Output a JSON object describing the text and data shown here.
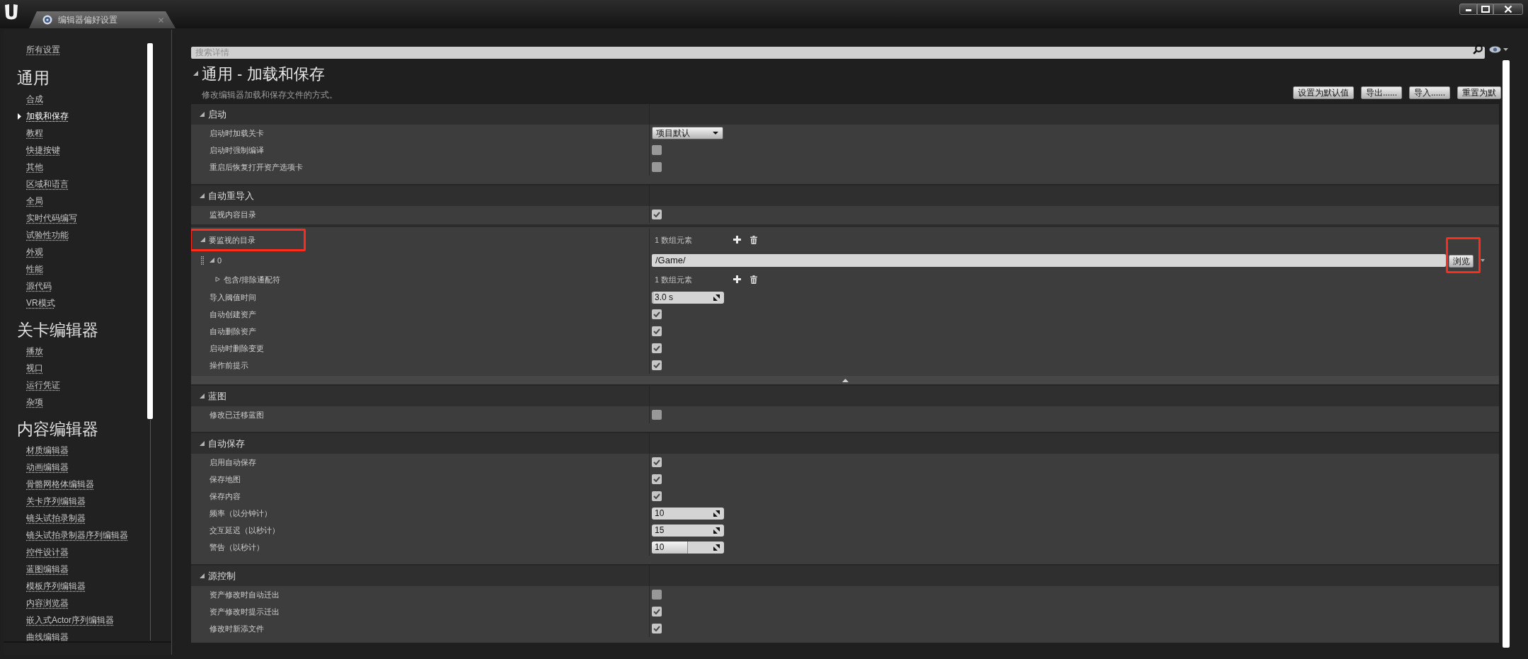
{
  "window": {
    "tab": {
      "title": "编辑器偏好设置"
    }
  },
  "sidebar": {
    "top_link": {
      "label": "所有设置",
      "selected": false
    },
    "sections": [
      {
        "heading": "通用",
        "items": [
          {
            "label": "合成",
            "selected": false
          },
          {
            "label": "加载和保存",
            "selected": true
          },
          {
            "label": "教程",
            "selected": false
          },
          {
            "label": "快捷按键",
            "selected": false
          },
          {
            "label": "其他",
            "selected": false
          },
          {
            "label": "区域和语言",
            "selected": false
          },
          {
            "label": "全局",
            "selected": false
          },
          {
            "label": "实时代码编写",
            "selected": false
          },
          {
            "label": "试验性功能",
            "selected": false
          },
          {
            "label": "外观",
            "selected": false
          },
          {
            "label": "性能",
            "selected": false
          },
          {
            "label": "源代码",
            "selected": false
          },
          {
            "label": "VR模式",
            "selected": false
          }
        ]
      },
      {
        "heading": "关卡编辑器",
        "items": [
          {
            "label": "播放",
            "selected": false
          },
          {
            "label": "视口",
            "selected": false
          },
          {
            "label": "运行凭证",
            "selected": false
          },
          {
            "label": "杂项",
            "selected": false
          }
        ]
      },
      {
        "heading": "内容编辑器",
        "items": [
          {
            "label": "材质编辑器",
            "selected": false
          },
          {
            "label": "动画编辑器",
            "selected": false
          },
          {
            "label": "骨骼网格体编辑器",
            "selected": false
          },
          {
            "label": "关卡序列编辑器",
            "selected": false
          },
          {
            "label": "镜头试拍录制器",
            "selected": false
          },
          {
            "label": "镜头试拍录制器序列编辑器",
            "selected": false
          },
          {
            "label": "控件设计器",
            "selected": false
          },
          {
            "label": "蓝图编辑器",
            "selected": false
          },
          {
            "label": "模板序列编辑器",
            "selected": false
          },
          {
            "label": "内容浏览器",
            "selected": false
          },
          {
            "label": "嵌入式Actor序列编辑器",
            "selected": false
          },
          {
            "label": "曲线编辑器",
            "selected": false
          }
        ]
      }
    ]
  },
  "search": {
    "placeholder": "搜索详情"
  },
  "header": {
    "title": "通用 - 加载和保存",
    "expanded": true,
    "description": "修改编辑器加载和保存文件的方式。",
    "buttons": [
      "设置为默认值",
      "导出......",
      "导入......",
      "重置为默"
    ]
  },
  "categories": [
    {
      "title": "启动",
      "expanded": true,
      "rows": [
        {
          "kind": "dropdown",
          "label": "启动时加载关卡",
          "value": "项目默认"
        },
        {
          "kind": "checkbox",
          "label": "启动时强制编译",
          "checked": false
        },
        {
          "kind": "checkbox",
          "label": "重启后恢复打开资产选项卡",
          "checked": false
        }
      ]
    },
    {
      "title": "自动重导入",
      "expanded": true,
      "advanced_expanded": true,
      "rows": [
        {
          "kind": "checkbox",
          "label": "监视内容目录",
          "checked": true
        },
        {
          "kind": "array",
          "label": "要监视的目录",
          "count": "1 数组元素",
          "expanded": true,
          "highlighted": true,
          "children": [
            {
              "kind": "element",
              "label": "0",
              "expanded": true,
              "value": "/Game/",
              "button": {
                "label": "浏览",
                "highlighted": true
              },
              "children": [
                {
                  "kind": "array",
                  "label": "包含/排除通配符",
                  "count": "1 数组元素",
                  "expanded": false
                }
              ]
            }
          ]
        },
        {
          "kind": "number",
          "label": "导入阈值时间",
          "value": "3.0 s",
          "level": 0.02
        },
        {
          "kind": "checkbox",
          "label": "自动创建资产",
          "checked": true
        },
        {
          "kind": "checkbox",
          "label": "自动删除资产",
          "checked": true
        },
        {
          "kind": "checkbox",
          "label": "启动时删除变更",
          "checked": true
        },
        {
          "kind": "checkbox",
          "label": "操作前提示",
          "checked": true
        }
      ]
    },
    {
      "title": "蓝图",
      "expanded": true,
      "rows": [
        {
          "kind": "checkbox",
          "label": "修改已迁移蓝图",
          "checked": false
        }
      ]
    },
    {
      "title": "自动保存",
      "expanded": true,
      "rows": [
        {
          "kind": "checkbox",
          "label": "启用自动保存",
          "checked": true
        },
        {
          "kind": "checkbox",
          "label": "保存地图",
          "checked": true
        },
        {
          "kind": "checkbox",
          "label": "保存内容",
          "checked": true
        },
        {
          "kind": "number",
          "label": "频率（以分钟计）",
          "value": "10"
        },
        {
          "kind": "number",
          "label": "交互延迟（以秒计）",
          "value": "15"
        },
        {
          "kind": "number",
          "label": "警告（以秒计）",
          "value": "10",
          "level": 0.5
        }
      ]
    },
    {
      "title": "源控制",
      "expanded": true,
      "rows": [
        {
          "kind": "checkbox",
          "label": "资产修改时自动迁出",
          "checked": false
        },
        {
          "kind": "checkbox",
          "label": "资产修改时提示迁出",
          "checked": true
        },
        {
          "kind": "checkbox",
          "label": "修改时新添文件",
          "checked": true
        }
      ]
    }
  ]
}
